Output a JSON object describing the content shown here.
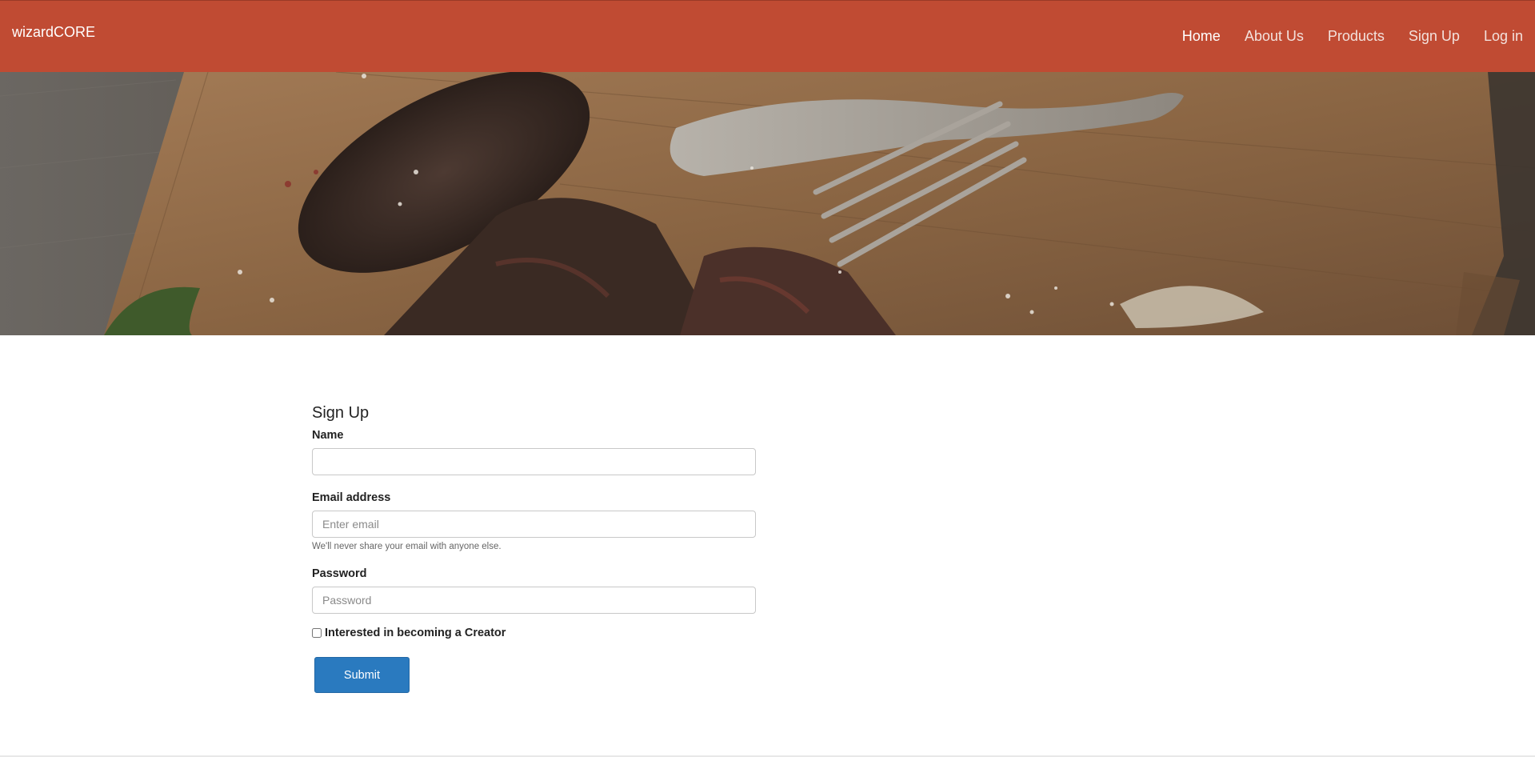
{
  "navbar": {
    "brand": "wizardCORE",
    "items": [
      {
        "label": "Home",
        "active": true
      },
      {
        "label": "About Us",
        "active": false
      },
      {
        "label": "Products",
        "active": false
      },
      {
        "label": "Sign Up",
        "active": false
      },
      {
        "label": "Log in",
        "active": false
      }
    ],
    "background_color": "#c04b33"
  },
  "form": {
    "title": "Sign Up",
    "name_label": "Name",
    "name_value": "",
    "email_label": "Email address",
    "email_placeholder": "Enter email",
    "email_help": "We'll never share your email with anyone else.",
    "password_label": "Password",
    "password_placeholder": "Password",
    "creator_checkbox_label": "Interested in becoming a Creator",
    "creator_checked": false,
    "submit_label": "Submit",
    "submit_color": "#2a7abf"
  }
}
